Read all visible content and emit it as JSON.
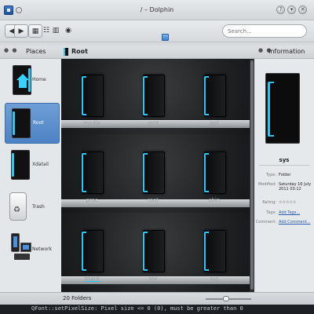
{
  "window": {
    "title": "/ – Dolphin"
  },
  "toolbar": {
    "back_icon": "arrow-left-icon",
    "forward_icon": "arrow-right-icon",
    "view_icons": [
      "icons-view-icon",
      "details-view-icon",
      "columns-view-icon",
      "preview-icon"
    ],
    "search_placeholder": "Search..."
  },
  "places": {
    "header": "Places",
    "items": [
      {
        "label": "Home"
      },
      {
        "label": "Root"
      },
      {
        "label": "Xdatail"
      },
      {
        "label": "Trash"
      },
      {
        "label": "Network"
      }
    ]
  },
  "view": {
    "header": "Root",
    "folders": [
      "media",
      "mnt",
      "opt",
      "proc",
      "root",
      "sbin",
      "share",
      "srv",
      "sys"
    ]
  },
  "info": {
    "header": "Information",
    "name": "sys",
    "rows": [
      {
        "key": "Type:",
        "value": "Folder"
      },
      {
        "key": "Modified:",
        "value": "Saturday 16 July 2011 03:12"
      },
      {
        "key": "Rating:",
        "value": "☆☆☆☆☆"
      },
      {
        "key": "Tags:",
        "value": "Add Tags..."
      },
      {
        "key": "Comment:",
        "value": "Add Comment..."
      }
    ]
  },
  "status": {
    "text": "20 Folders"
  },
  "console": {
    "text": "QFont::setPixelSize: Pixel size <= 0 (0), must be greater than 0"
  },
  "colors": {
    "accent": "#27c6f5",
    "selection": "#4c82c4"
  }
}
